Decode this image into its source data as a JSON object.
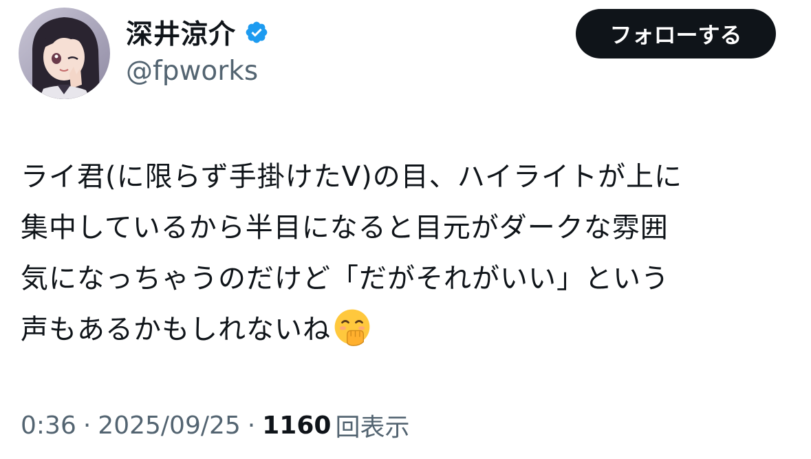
{
  "author": {
    "display_name": "深井涼介",
    "handle": "@fpworks",
    "verified": true,
    "avatar_icon": "anime-girl-avatar"
  },
  "follow_button": {
    "label": "フォローする"
  },
  "tweet": {
    "lines": [
      "ライ君(に限らず手掛けたV)の目、ハイライトが上に",
      "集中しているから半目になると目元がダークな雰囲",
      "気になっちゃうのだけど「だがそれがいい」という",
      "声もあるかもしれないね"
    ],
    "trailing_emoji": "face-with-hand-over-mouth-icon"
  },
  "meta": {
    "time": "0:36",
    "separator": "·",
    "date": "2025/09/25",
    "views_count": "1160",
    "views_label": "回表示"
  },
  "colors": {
    "text_primary": "#0f1419",
    "text_secondary": "#536471",
    "verified_blue": "#1d9bf0",
    "follow_bg": "#0f1419"
  }
}
